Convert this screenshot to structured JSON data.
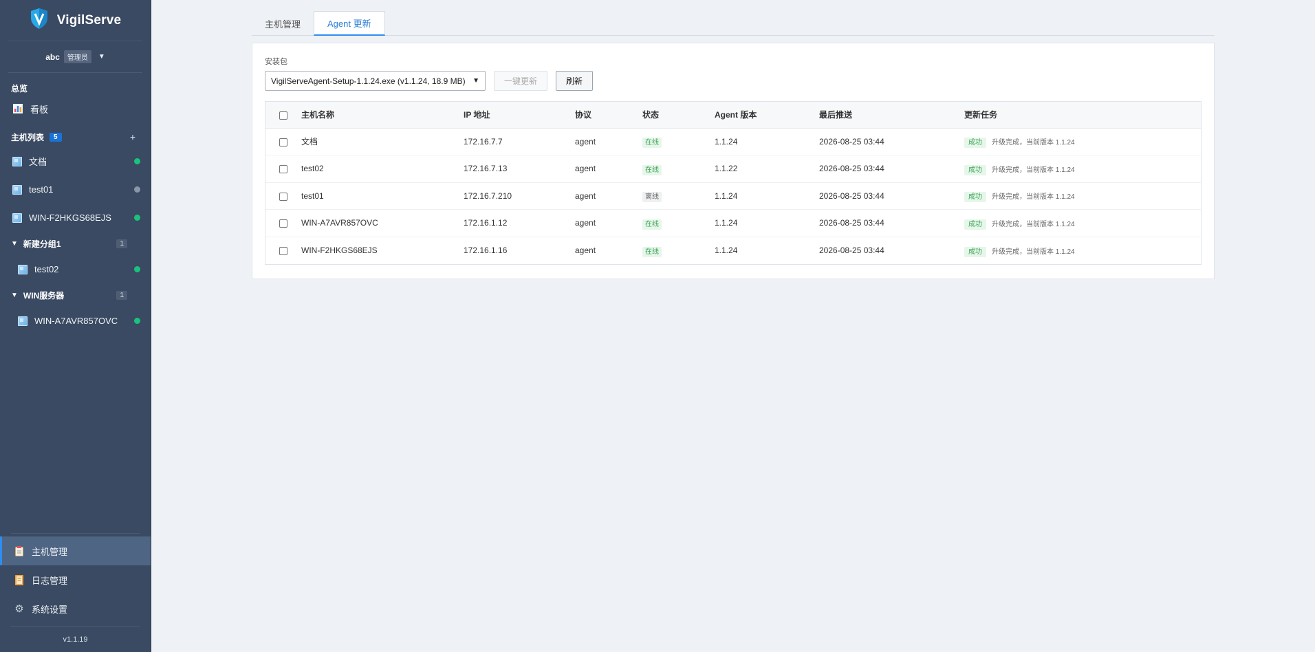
{
  "brand": {
    "title": "VigilServe"
  },
  "user": {
    "name": "abc",
    "role": "管理员"
  },
  "sidebar": {
    "overview_label": "总览",
    "dashboard_label": "看板",
    "host_list_label": "主机列表",
    "host_count": "5",
    "hosts": [
      {
        "name": "文档",
        "status": "online"
      },
      {
        "name": "test01",
        "status": "offline"
      },
      {
        "name": "WIN-F2HKGS68EJS",
        "status": "online"
      }
    ],
    "groups": [
      {
        "name": "新建分组1",
        "count": "1",
        "hosts": [
          {
            "name": "test02",
            "status": "online"
          }
        ]
      },
      {
        "name": "WIN服务器",
        "count": "1",
        "hosts": [
          {
            "name": "WIN-A7AVR857OVC",
            "status": "online"
          }
        ]
      }
    ],
    "bottom_nav": [
      {
        "label": "主机管理",
        "icon": "clipboard-icon",
        "active": true
      },
      {
        "label": "日志管理",
        "icon": "book-icon",
        "active": false
      },
      {
        "label": "系统设置",
        "icon": "gear-icon",
        "active": false
      }
    ],
    "version": "v1.1.19"
  },
  "tabs": [
    {
      "label": "主机管理",
      "active": false
    },
    {
      "label": "Agent 更新",
      "active": true
    }
  ],
  "package": {
    "label": "安装包",
    "selected": "VigilServeAgent-Setup-1.1.24.exe (v1.1.24, 18.9 MB)",
    "update_all_button": "一键更新",
    "refresh_button": "刷新"
  },
  "table": {
    "columns": [
      "主机名称",
      "IP 地址",
      "协议",
      "状态",
      "Agent 版本",
      "最后推送",
      "更新任务"
    ],
    "rows": [
      {
        "host": "文档",
        "ip": "172.16.7.7",
        "protocol": "agent",
        "status": "在线",
        "status_type": "online",
        "version": "1.1.24",
        "last_push": "2026-08-25 03:44",
        "task_status": "成功",
        "task_text": "升级完成，当前版本 1.1.24"
      },
      {
        "host": "test02",
        "ip": "172.16.7.13",
        "protocol": "agent",
        "status": "在线",
        "status_type": "online",
        "version": "1.1.22",
        "last_push": "2026-08-25 03:44",
        "task_status": "成功",
        "task_text": "升级完成，当前版本 1.1.24"
      },
      {
        "host": "test01",
        "ip": "172.16.7.210",
        "protocol": "agent",
        "status": "离线",
        "status_type": "offline",
        "version": "1.1.24",
        "last_push": "2026-08-25 03:44",
        "task_status": "成功",
        "task_text": "升级完成，当前版本 1.1.24"
      },
      {
        "host": "WIN-A7AVR857OVC",
        "ip": "172.16.1.12",
        "protocol": "agent",
        "status": "在线",
        "status_type": "online",
        "version": "1.1.24",
        "last_push": "2026-08-25 03:44",
        "task_status": "成功",
        "task_text": "升级完成，当前版本 1.1.24"
      },
      {
        "host": "WIN-F2HKGS68EJS",
        "ip": "172.16.1.16",
        "protocol": "agent",
        "status": "在线",
        "status_type": "online",
        "version": "1.1.24",
        "last_push": "2026-08-25 03:44",
        "task_status": "成功",
        "task_text": "升级完成，当前版本 1.1.24"
      }
    ]
  },
  "colors": {
    "sidebar_bg": "#3a4a62",
    "accent": "#2f8cf0",
    "online": "#19c37d",
    "success_text": "#3aa655"
  }
}
